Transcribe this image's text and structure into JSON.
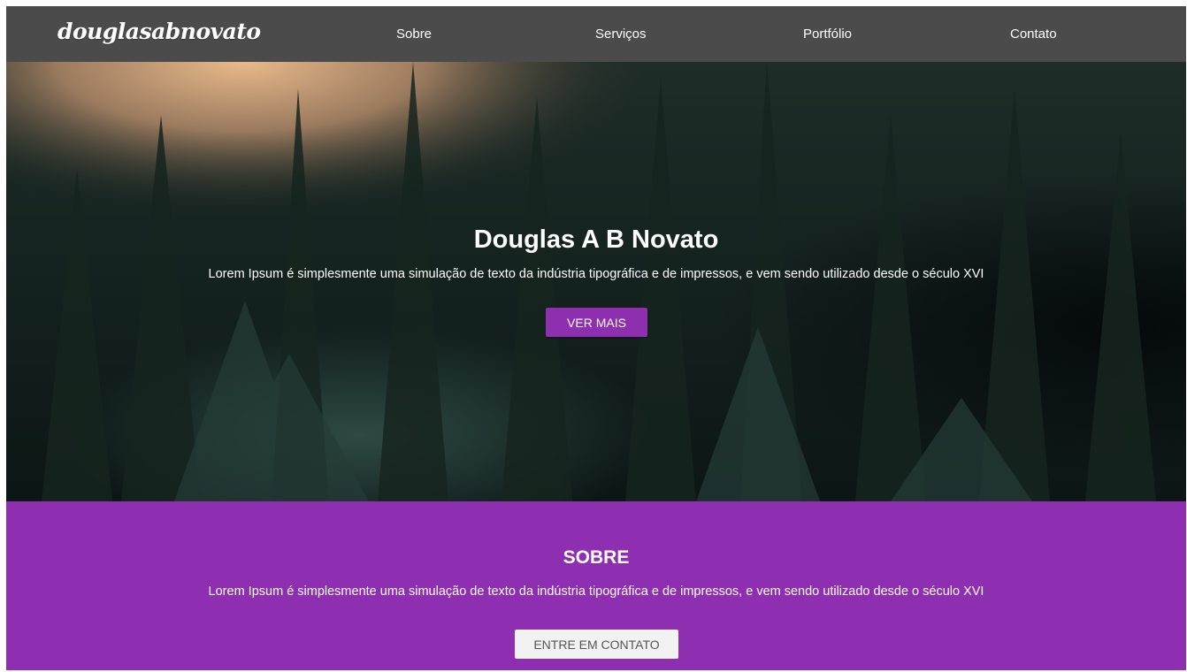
{
  "header": {
    "logo": "douglasabnovato",
    "nav": [
      {
        "label": "Sobre"
      },
      {
        "label": "Serviços"
      },
      {
        "label": "Portfólio"
      },
      {
        "label": "Contato"
      }
    ]
  },
  "hero": {
    "title": "Douglas A B Novato",
    "text": "Lorem Ipsum é simplesmente uma simulação de texto da indústria tipográfica e de impressos, e vem sendo utilizado desde o século XVI",
    "button_label": "VER MAIS",
    "background": "forest-image"
  },
  "about": {
    "title": "SOBRE",
    "text": "Lorem Ipsum é simplesmente uma simulação de texto da indústria tipográfica e de impressos, e vem sendo utilizado desde o século XVI",
    "button_label": "ENTRE EM CONTATO"
  },
  "colors": {
    "header_bg": "#4b4b4b",
    "accent": "#8e2eb0",
    "hero_overlay": "#0b1714",
    "button_light": "#f2f2f2"
  }
}
